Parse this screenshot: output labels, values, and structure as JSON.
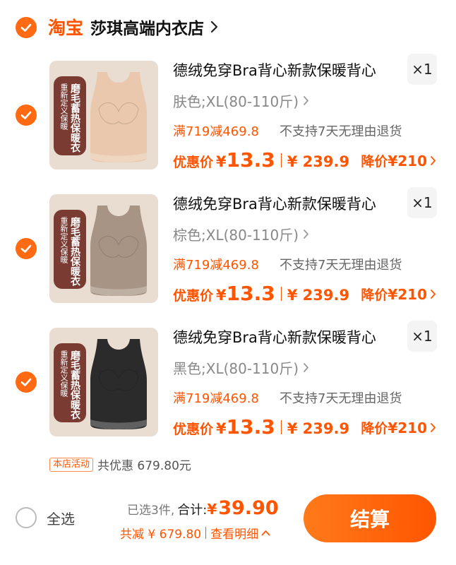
{
  "store": {
    "platform": "淘宝",
    "name": "莎琪高端内衣店",
    "checked": true
  },
  "items": [
    {
      "title": "德绒免穿Bra背心新款保暖背心",
      "quantity": "×1",
      "spec": "肤色;XL(80-110斤)",
      "promo": "满719减469.8",
      "policy": "不支持7天无理由退货",
      "price_label": "优惠价",
      "price_currency": "¥",
      "price_value": "13.3",
      "orig_price": "¥ 239.9",
      "drop_label": "降价",
      "drop_value": "¥210",
      "badge_small": "重新定义保暖",
      "badge_big": "磨毛蓄热保暖衣",
      "color": "#e9c8ad"
    },
    {
      "title": "德绒免穿Bra背心新款保暖背心",
      "quantity": "×1",
      "spec": "棕色;XL(80-110斤)",
      "promo": "满719减469.8",
      "policy": "不支持7天无理由退货",
      "price_label": "优惠价",
      "price_currency": "¥",
      "price_value": "13.3",
      "orig_price": "¥ 239.9",
      "drop_label": "降价",
      "drop_value": "¥210",
      "badge_small": "重新定义保暖",
      "badge_big": "磨毛蓄热保暖衣",
      "color": "#a89484"
    },
    {
      "title": "德绒免穿Bra背心新款保暖背心",
      "quantity": "×1",
      "spec": "黑色;XL(80-110斤)",
      "promo": "满719减469.8",
      "policy": "不支持7天无理由退货",
      "price_label": "优惠价",
      "price_currency": "¥",
      "price_value": "13.3",
      "orig_price": "¥ 239.9",
      "drop_label": "降价",
      "drop_value": "¥210",
      "badge_small": "重新定义保暖",
      "badge_big": "磨毛蓄热保暖衣",
      "color": "#2b2b2b"
    }
  ],
  "activity": {
    "tag": "本店活动",
    "text": "共优惠 679.80元"
  },
  "footer": {
    "select_all_label": "全选",
    "selected_count": "已选3件,",
    "total_label": "合计:",
    "total_currency": "¥",
    "total_value": "39.90",
    "discount_text": "共减 ¥ 679.80",
    "detail_link": "查看明细",
    "checkout_label": "结算"
  },
  "colors": {
    "accent": "#ff5500",
    "check": "#ff6a13"
  }
}
